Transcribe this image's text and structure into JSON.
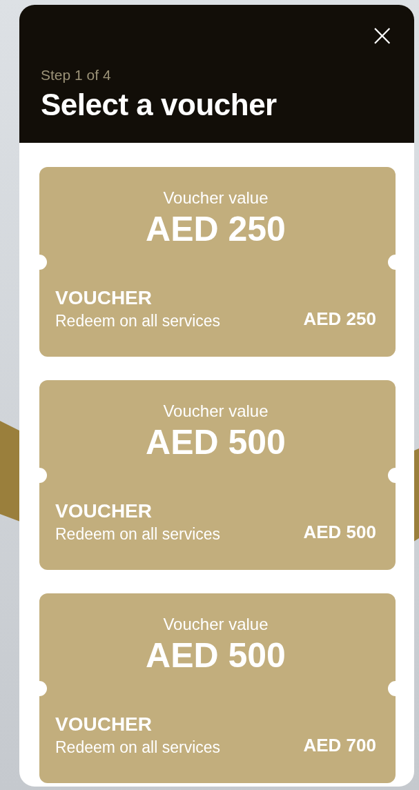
{
  "header": {
    "step": "Step 1 of 4",
    "title": "Select a voucher",
    "close": "×"
  },
  "vouchers": [
    {
      "label": "Voucher value",
      "amount": "AED 250",
      "title": "VOUCHER",
      "description": "Redeem on all services",
      "price": "AED 250"
    },
    {
      "label": "Voucher value",
      "amount": "AED 500",
      "title": "VOUCHER",
      "description": "Redeem on all services",
      "price": "AED 500"
    },
    {
      "label": "Voucher value",
      "amount": "AED 500",
      "title": "VOUCHER",
      "description": "Redeem on all services",
      "price": "AED 700"
    }
  ]
}
